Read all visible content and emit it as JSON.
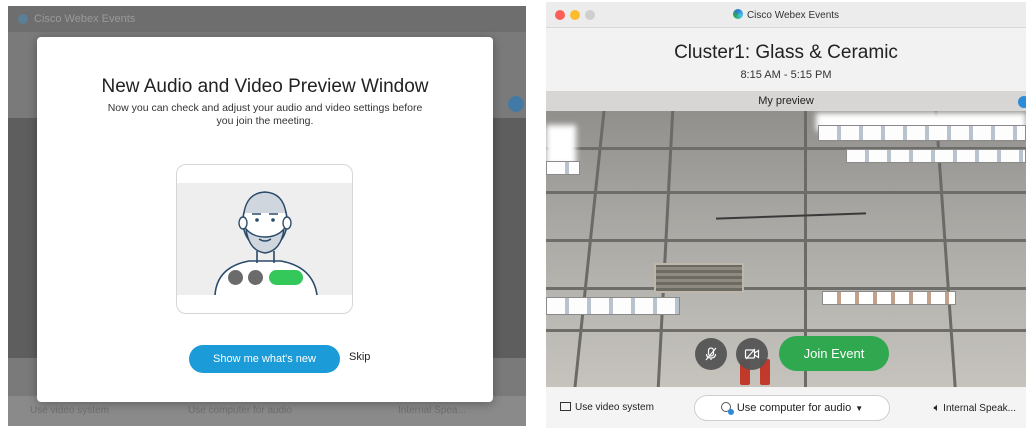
{
  "left": {
    "background_title": "Cisco Webex Events",
    "background_bottom_items": [
      "Use video system",
      "Use computer for audio",
      "Internal Spea..."
    ],
    "modal": {
      "title": "New Audio and Video Preview Window",
      "description": "Now you can check and adjust your audio and video settings before you join the meeting.",
      "primary_button": "Show me what's new",
      "secondary_button": "Skip"
    }
  },
  "right": {
    "app_title": "Cisco Webex Events",
    "event_title": "Cluster1: Glass & Ceramic",
    "event_time": "8:15 AM - 5:15 PM",
    "preview_label": "My preview",
    "join_button": "Join Event",
    "bottom": {
      "video_system": "Use video system",
      "audio_option": "Use computer for audio",
      "speaker": "Internal Speak..."
    }
  },
  "colors": {
    "primary_blue": "#1b9bd8",
    "join_green": "#2fa84f",
    "mac_red": "#fc5f57",
    "mac_yellow": "#fdbb2e"
  },
  "icons": [
    "webex-logo-icon",
    "mute-mic-icon",
    "camera-off-icon",
    "video-system-icon",
    "computer-audio-icon",
    "speaker-icon",
    "dropdown-caret-icon"
  ]
}
